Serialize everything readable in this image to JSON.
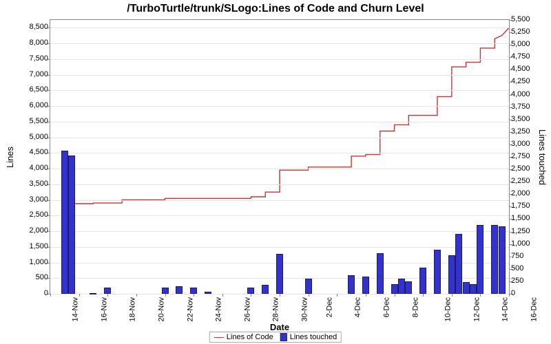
{
  "title": "/TurboTurtle/trunk/SLogo:Lines of Code and Churn Level",
  "xlabel": "Date",
  "ylabel_left": "Lines",
  "ylabel_right": "Lines touched",
  "legend": {
    "series1": "Lines of Code",
    "series2": "Lines touched"
  },
  "chart_data": {
    "type": "bar+line (dual-axis)",
    "x_categories": [
      "14-Nov",
      "16-Nov",
      "18-Nov",
      "20-Nov",
      "22-Nov",
      "24-Nov",
      "26-Nov",
      "28-Nov",
      "30-Nov",
      "2-Dec",
      "4-Dec",
      "6-Dec",
      "8-Dec",
      "10-Dec",
      "12-Dec",
      "14-Dec",
      "16-Dec"
    ],
    "left_axis": {
      "min": 0,
      "max": 8750,
      "step": 500
    },
    "right_axis": {
      "min": 0,
      "max": 5500,
      "step": 250
    },
    "series": [
      {
        "name": "Lines of Code",
        "axis": "left",
        "type": "line",
        "color": "#cc3333",
        "points": [
          {
            "x": "15-Nov",
            "y": 0
          },
          {
            "x": "15-Nov",
            "y": 2880
          },
          {
            "x": "17-Nov",
            "y": 2880
          },
          {
            "x": "17-Nov",
            "y": 2900
          },
          {
            "x": "19-Nov",
            "y": 2900
          },
          {
            "x": "19-Nov",
            "y": 3000
          },
          {
            "x": "22-Nov",
            "y": 3000
          },
          {
            "x": "22-Nov",
            "y": 3050
          },
          {
            "x": "28-Nov",
            "y": 3050
          },
          {
            "x": "28-Nov",
            "y": 3100
          },
          {
            "x": "29-Nov",
            "y": 3100
          },
          {
            "x": "29-Nov",
            "y": 3250
          },
          {
            "x": "30-Nov",
            "y": 3250
          },
          {
            "x": "30-Nov",
            "y": 3950
          },
          {
            "x": "2-Dec",
            "y": 3950
          },
          {
            "x": "2-Dec",
            "y": 4050
          },
          {
            "x": "5-Dec",
            "y": 4050
          },
          {
            "x": "5-Dec",
            "y": 4400
          },
          {
            "x": "6-Dec",
            "y": 4400
          },
          {
            "x": "6-Dec",
            "y": 4450
          },
          {
            "x": "7-Dec",
            "y": 4450
          },
          {
            "x": "7-Dec",
            "y": 5200
          },
          {
            "x": "8-Dec",
            "y": 5200
          },
          {
            "x": "8-Dec",
            "y": 5400
          },
          {
            "x": "9-Dec",
            "y": 5400
          },
          {
            "x": "9-Dec",
            "y": 5700
          },
          {
            "x": "11-Dec",
            "y": 5700
          },
          {
            "x": "11-Dec",
            "y": 6300
          },
          {
            "x": "12-Dec",
            "y": 6300
          },
          {
            "x": "12-Dec",
            "y": 7250
          },
          {
            "x": "13-Dec",
            "y": 7250
          },
          {
            "x": "13-Dec",
            "y": 7400
          },
          {
            "x": "14-Dec",
            "y": 7400
          },
          {
            "x": "14-Dec",
            "y": 7850
          },
          {
            "x": "15-Dec",
            "y": 7850
          },
          {
            "x": "15-Dec",
            "y": 8150
          },
          {
            "x": "15.5-Dec",
            "y": 8250
          },
          {
            "x": "16-Dec",
            "y": 8500
          }
        ]
      },
      {
        "name": "Lines touched",
        "axis": "right",
        "type": "bar",
        "color": "#3333cc",
        "bars": [
          {
            "x": "15-Nov",
            "y": 2880
          },
          {
            "x": "15.5-Nov",
            "y": 2780
          },
          {
            "x": "17-Nov",
            "y": 20
          },
          {
            "x": "18-Nov",
            "y": 120
          },
          {
            "x": "22-Nov",
            "y": 130
          },
          {
            "x": "23-Nov",
            "y": 150
          },
          {
            "x": "24-Nov",
            "y": 130
          },
          {
            "x": "25-Nov",
            "y": 40
          },
          {
            "x": "28-Nov",
            "y": 120
          },
          {
            "x": "29-Nov",
            "y": 180
          },
          {
            "x": "30-Nov",
            "y": 800
          },
          {
            "x": "2-Dec",
            "y": 300
          },
          {
            "x": "5-Dec",
            "y": 380
          },
          {
            "x": "6-Dec",
            "y": 350
          },
          {
            "x": "7-Dec",
            "y": 820
          },
          {
            "x": "8-Dec",
            "y": 200
          },
          {
            "x": "8.5-Dec",
            "y": 300
          },
          {
            "x": "9-Dec",
            "y": 250
          },
          {
            "x": "10-Dec",
            "y": 520
          },
          {
            "x": "11-Dec",
            "y": 880
          },
          {
            "x": "12-Dec",
            "y": 780
          },
          {
            "x": "12.5-Dec",
            "y": 1200
          },
          {
            "x": "13-Dec",
            "y": 230
          },
          {
            "x": "13.5-Dec",
            "y": 200
          },
          {
            "x": "14-Dec",
            "y": 1380
          },
          {
            "x": "15-Dec",
            "y": 1380
          },
          {
            "x": "15.5-Dec",
            "y": 1350
          }
        ]
      }
    ]
  }
}
